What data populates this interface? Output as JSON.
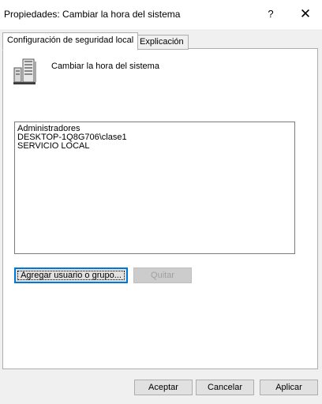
{
  "window": {
    "title": "Propiedades: Cambiar la hora del sistema",
    "help_label": "?",
    "close_label": "✕"
  },
  "tabs": [
    {
      "label": "Configuración de seguridad local",
      "active": true
    },
    {
      "label": "Explicación",
      "active": false
    }
  ],
  "policy": {
    "name": "Cambiar la hora del sistema",
    "icon": "server-policy-icon"
  },
  "members": [
    "Administradores",
    "DESKTOP-1Q8G706\\clase1",
    "SERVICIO LOCAL"
  ],
  "buttons": {
    "add": "Agregar usuario o grupo...",
    "remove": "Quitar",
    "ok": "Aceptar",
    "cancel": "Cancelar",
    "apply": "Aplicar"
  },
  "colors": {
    "focus_border": "#0078d7",
    "disabled_text": "#a0a0a0"
  }
}
